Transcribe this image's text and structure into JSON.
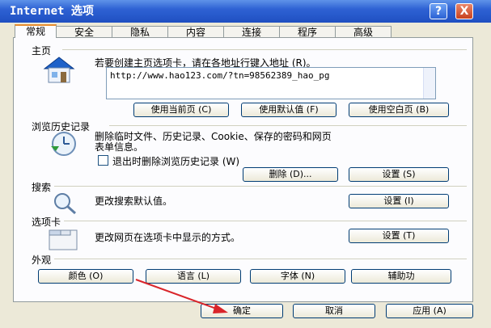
{
  "window": {
    "title": "Internet 选项"
  },
  "title_buttons": {
    "help": "?",
    "close": "X"
  },
  "tabs": [
    "常规",
    "安全",
    "隐私",
    "内容",
    "连接",
    "程序",
    "高级"
  ],
  "home": {
    "heading": "主页",
    "description": "若要创建主页选项卡，请在各地址行键入地址 (R)。",
    "url": "http://www.hao123.com/?tn=98562389_hao_pg",
    "btn_current": "使用当前页 (C)",
    "btn_default": "使用默认值 (F)",
    "btn_blank": "使用空白页 (B)"
  },
  "history": {
    "heading": "浏览历史记录",
    "description_line1": "删除临时文件、历史记录、Cookie、保存的密码和网页",
    "description_line2": "表单信息。",
    "checkbox_label": "退出时删除浏览历史记录 (W)",
    "btn_delete": "删除 (D)...",
    "btn_settings": "设置 (S)"
  },
  "search": {
    "heading": "搜索",
    "description": "更改搜索默认值。",
    "btn_settings": "设置 (I)"
  },
  "tabs_section": {
    "heading": "选项卡",
    "description": "更改网页在选项卡中显示的方式。",
    "btn_settings": "设置 (T)"
  },
  "appearance": {
    "heading": "外观",
    "btn_colors": "颜色 (O)",
    "btn_languages": "语言 (L)",
    "btn_fonts": "字体 (N)",
    "btn_accessibility": "辅助功"
  },
  "footer": {
    "btn_ok": "确定",
    "btn_cancel": "取消",
    "btn_apply": "应用 (A)"
  },
  "annotation_color": "#d9252a"
}
